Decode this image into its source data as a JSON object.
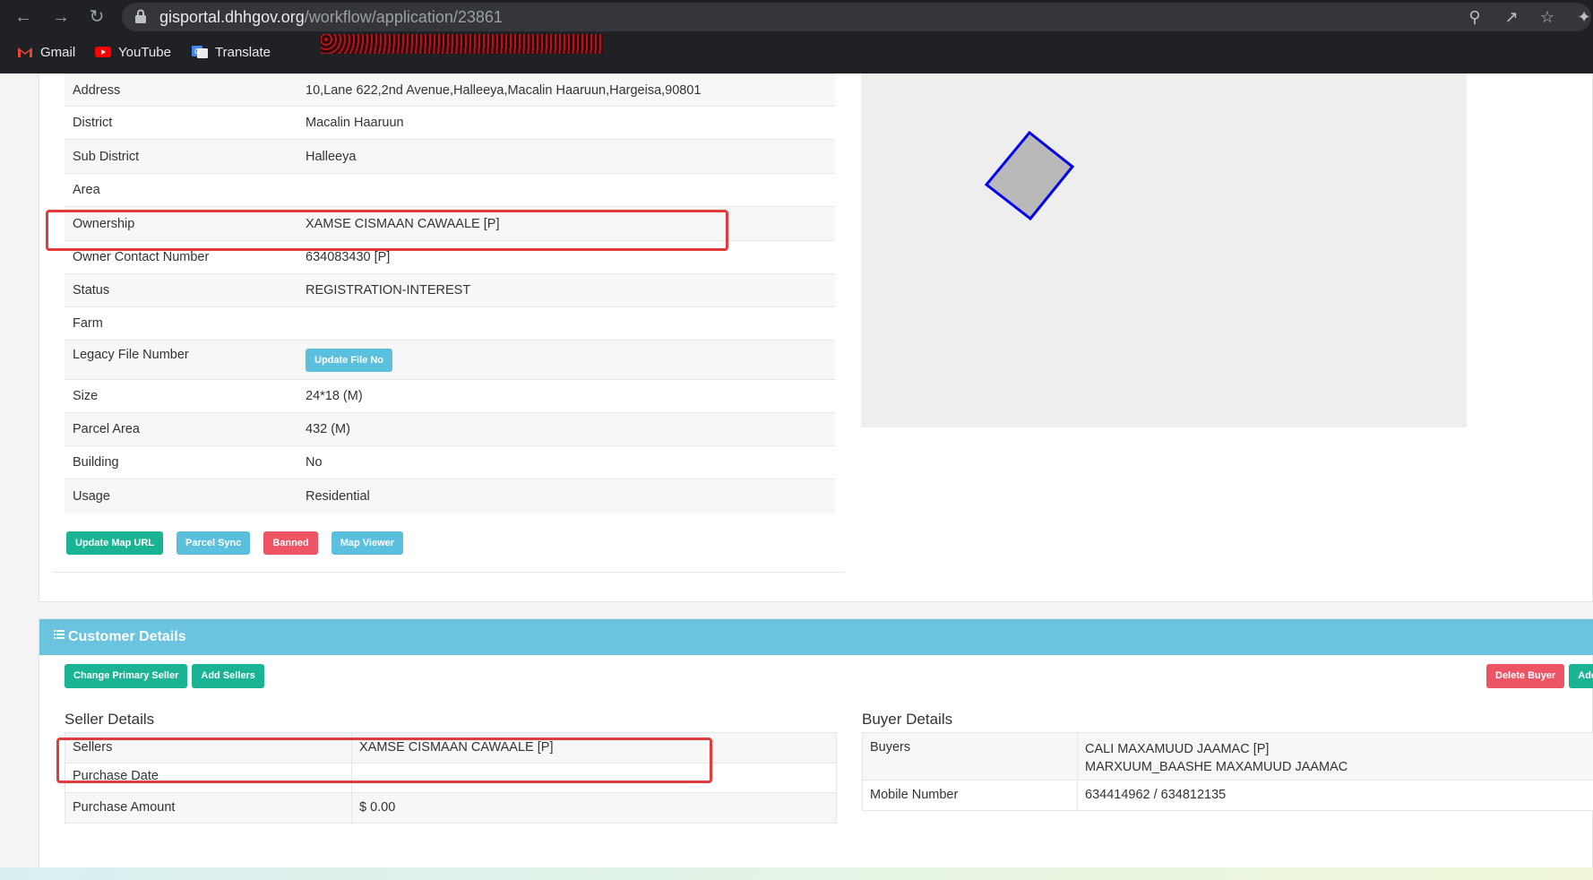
{
  "browser": {
    "url_host": "gisportal.dhhgov.org",
    "url_path": "/workflow/application/23861",
    "bookmarks": [
      {
        "label": "Gmail",
        "icon": "gmail-icon"
      },
      {
        "label": "YouTube",
        "icon": "youtube-icon"
      },
      {
        "label": "Translate",
        "icon": "translate-icon"
      }
    ]
  },
  "parcel": {
    "rows": [
      {
        "key": "Address",
        "value": "10,Lane 622,2nd Avenue,Halleeya,Macalin Haaruun,Hargeisa,90801"
      },
      {
        "key": "District",
        "value": "Macalin Haaruun"
      },
      {
        "key": "Sub District",
        "value": "Halleeya"
      },
      {
        "key": "Area",
        "value": ""
      },
      {
        "key": "Ownership",
        "value": "XAMSE CISMAAN CAWAALE [P]"
      },
      {
        "key": "Owner Contact Number",
        "value": "634083430 [P]"
      },
      {
        "key": "Status",
        "value": "REGISTRATION-INTEREST"
      },
      {
        "key": "Farm",
        "value": ""
      },
      {
        "key": "Legacy File Number",
        "value": ""
      },
      {
        "key": "Size",
        "value": "24*18 (M)"
      },
      {
        "key": "Parcel Area",
        "value": "432 (M)"
      },
      {
        "key": "Building",
        "value": "No"
      },
      {
        "key": "Usage",
        "value": "Residential"
      }
    ],
    "update_file_no_label": "Update File No",
    "actions": {
      "update_map_url": "Update Map URL",
      "parcel_sync": "Parcel Sync",
      "banned": "Banned",
      "map_viewer": "Map Viewer"
    }
  },
  "customer": {
    "header": "Customer Details",
    "change_primary_seller": "Change Primary Seller",
    "add_sellers": "Add Sellers",
    "delete_buyer": "Delete Buyer",
    "add_buyer_partial": "Add",
    "seller_title": "Seller Details",
    "seller_rows": [
      {
        "key": "Sellers",
        "value": "XAMSE CISMAAN CAWAALE [P]"
      },
      {
        "key": "Purchase Date",
        "value": ""
      },
      {
        "key": "Purchase Amount",
        "value": "$ 0.00"
      }
    ],
    "buyer_title": "Buyer Details",
    "buyers_label": "Buyers",
    "buyers": [
      "CALI MAXAMUUD JAAMAC [P]",
      "MARXUUM_BAASHE MAXAMUUD JAAMAC"
    ],
    "mobile_label": "Mobile Number",
    "mobile_value": "634414962 / 634812135"
  },
  "colors": {
    "highlight_box": "#e23b3b",
    "header_bg": "#6ac4e0",
    "parcel_stroke": "#0000ee"
  }
}
